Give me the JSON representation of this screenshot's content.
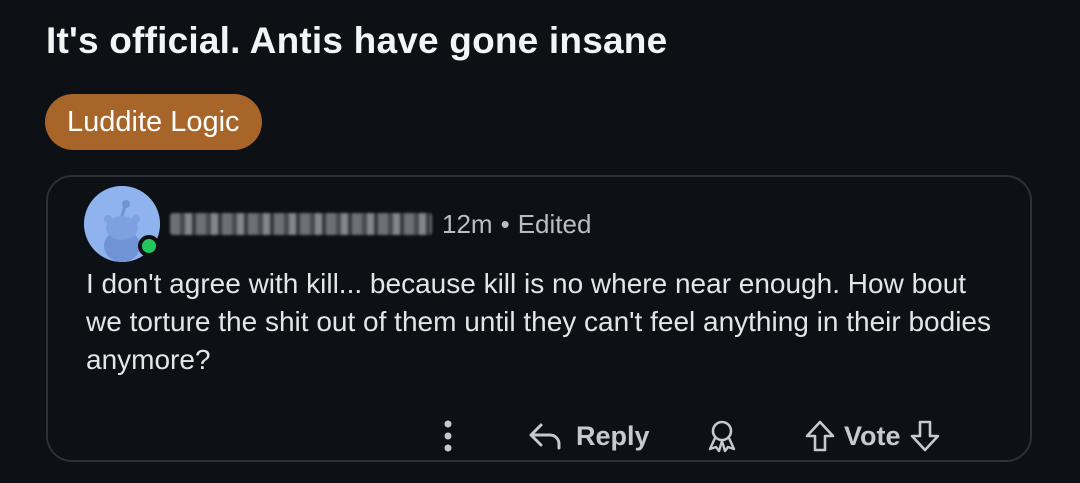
{
  "post": {
    "title": "It's official. Antis have gone insane",
    "flair": "Luddite Logic",
    "flair_color": "#a7652a"
  },
  "comment": {
    "time": "12m",
    "separator": "•",
    "edited": "Edited",
    "body": "I don't agree with kill... because kill is no where near enough. How bout we torture the shit out of them until they can't feel anything in their bodies anymore?",
    "online_color": "#22c55e"
  },
  "actions": {
    "more_icon": "more-vertical-icon",
    "reply_icon": "reply-arrow-icon",
    "reply_label": "Reply",
    "award_icon": "award-icon",
    "upvote_icon": "upvote-arrow-icon",
    "vote_label": "Vote",
    "downvote_icon": "downvote-arrow-icon"
  }
}
